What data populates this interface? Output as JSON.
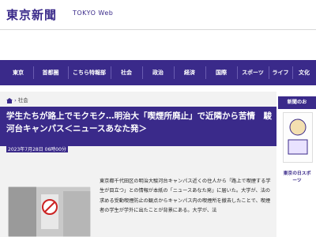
{
  "header": {
    "logo_text": "東京新聞",
    "logo_sub": "TOKYO Web"
  },
  "nav": {
    "items": [
      {
        "label": "東京"
      },
      {
        "label": "首都圏"
      },
      {
        "label": "こちら特報部"
      },
      {
        "label": "社会"
      },
      {
        "label": "政治"
      },
      {
        "label": "経済"
      },
      {
        "label": "国際"
      },
      {
        "label": "スポーツ"
      },
      {
        "label": "ライフ"
      },
      {
        "label": "文化"
      }
    ]
  },
  "breadcrumb": {
    "category": "社会"
  },
  "article": {
    "title": "学生たちが路上でモクモク…明治大「喫煙所廃止」で近隣から苦情　駿河台キャンパス＜ニュースあなた発＞",
    "date": "2023年7月28日 06時00分",
    "body": "東京都千代田区の明治大駿河台キャンパス近くの住人から「路上で喫煙する学生が目立つ」との情報が本紙の「ニュースあなた発」に届いた。大学が、法の求める受動喫煙防止の観点からキャンパス内の喫煙所を撤去したことで、喫煙者の学生が学外に出たことが背景にある。大学が、法"
  },
  "sidebar": {
    "heading": "新聞のお",
    "ad_caption": "東京の日スポーツ"
  },
  "colors": {
    "brand": "#3a2a8a"
  }
}
